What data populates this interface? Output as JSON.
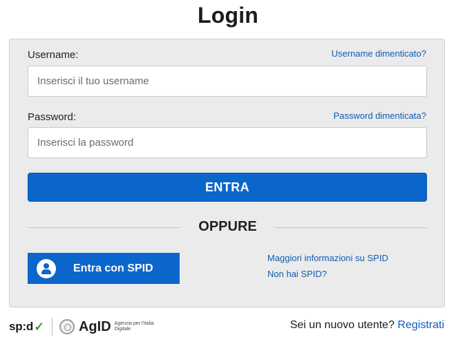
{
  "page": {
    "title": "Login"
  },
  "form": {
    "username_label": "Username:",
    "username_forgot": "Username dimenticato?",
    "username_placeholder": "Inserisci il tuo username",
    "username_value": "",
    "password_label": "Password:",
    "password_forgot": "Password dimenticata?",
    "password_placeholder": "Inserisci la password",
    "password_value": "",
    "submit_label": "ENTRA"
  },
  "separator": {
    "label": "OPPURE"
  },
  "spid": {
    "button_label": "Entra con SPID",
    "button_icon": "user-icon",
    "more_info_link": "Maggiori informazioni su SPID",
    "no_spid_link": "Non hai SPID?"
  },
  "footer": {
    "spid_logo_text": "sp:d",
    "spid_logo_check": "✓",
    "agid_logo_text": "AgID",
    "agid_tagline": "Agenzia per l'Italia Digitale",
    "new_user_text": "Sei un nuovo utente?",
    "register_link": "Registrati"
  },
  "colors": {
    "primary": "#0b66cc",
    "link": "#0f5bb3",
    "panel_bg": "#ebebeb"
  }
}
